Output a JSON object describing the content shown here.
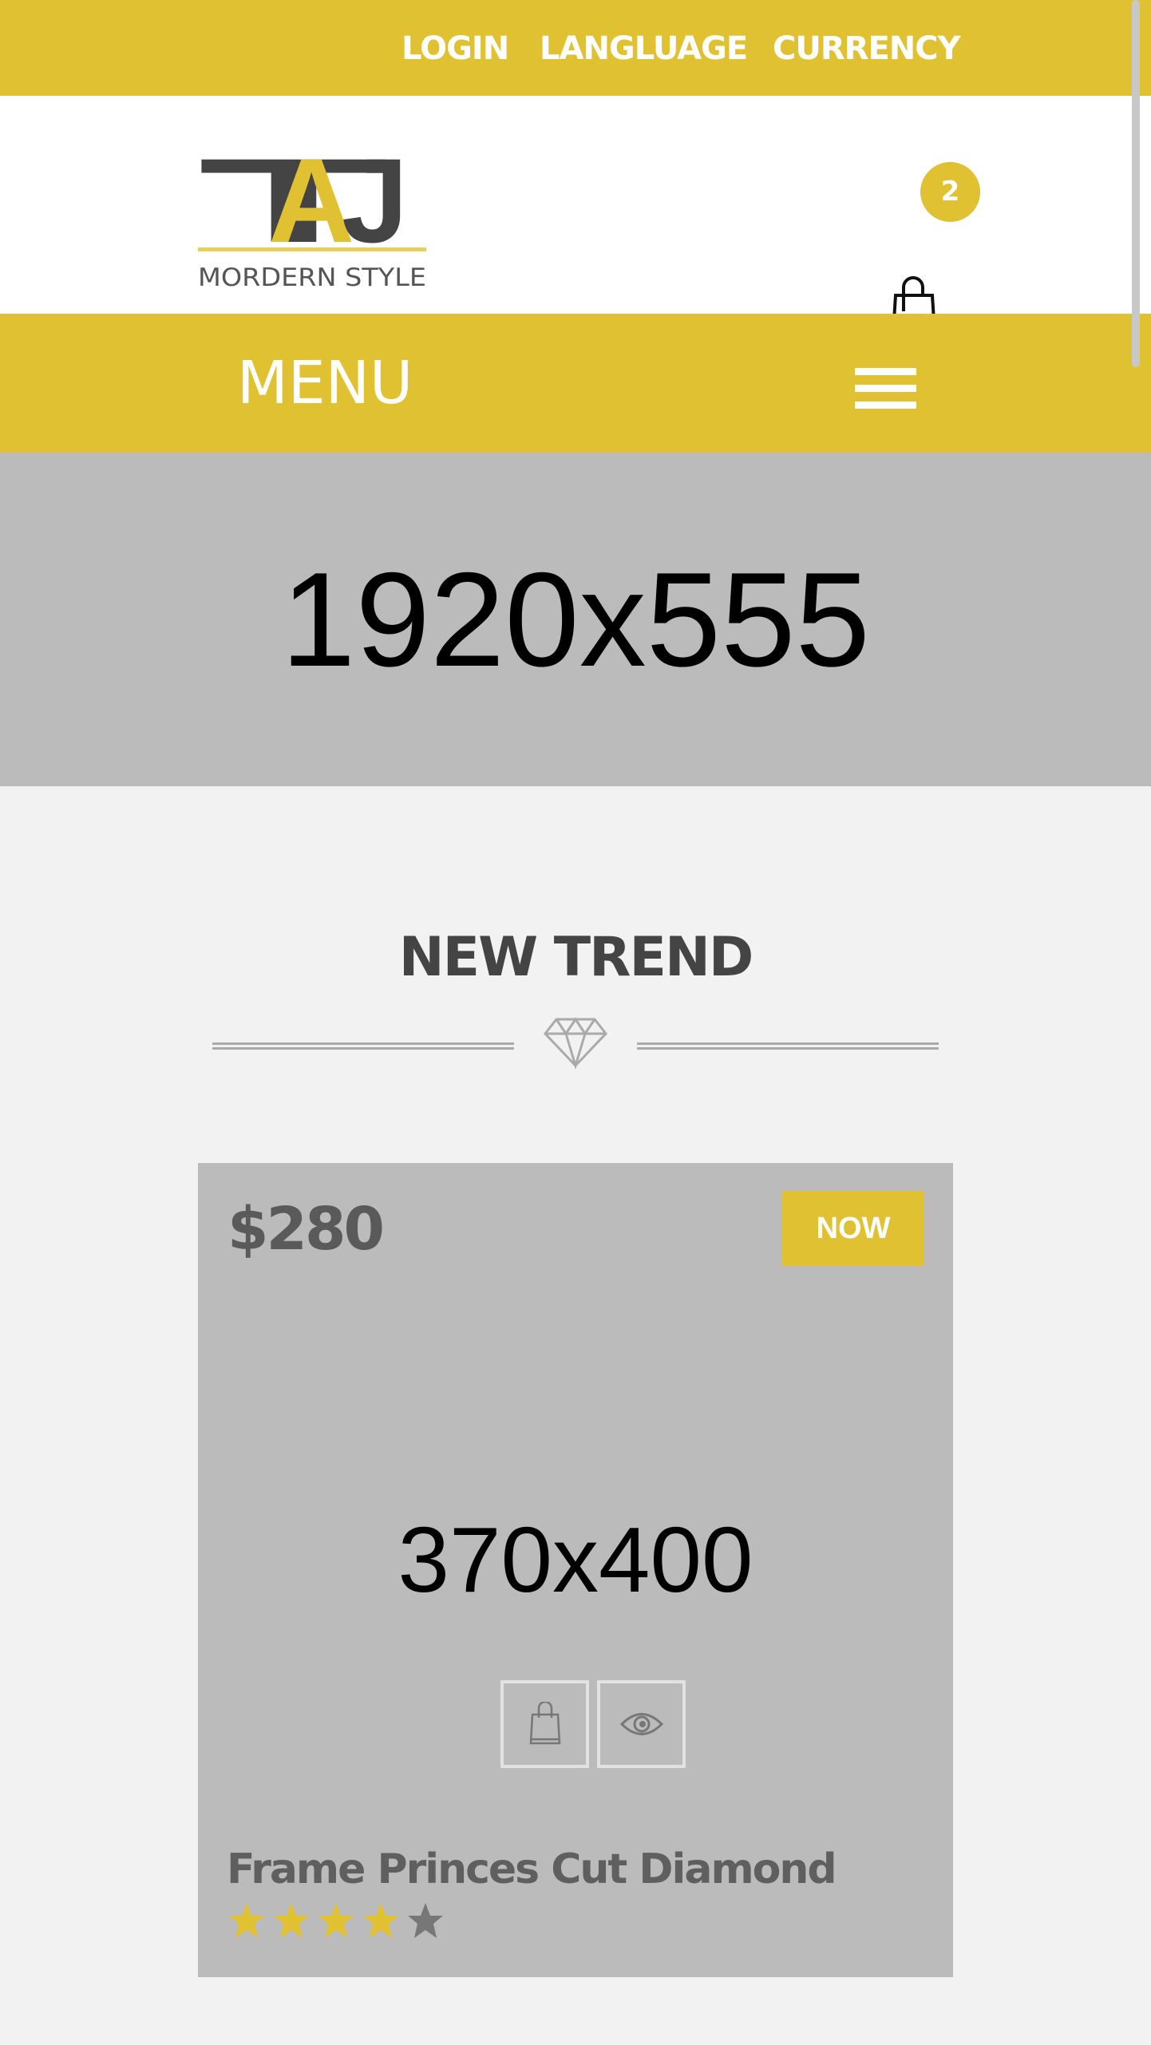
{
  "topbar": {
    "links": [
      "LOGIN",
      "LANGLUAGE",
      "CURRENCY"
    ]
  },
  "header": {
    "logo_text": "TAJ",
    "logo_tagline": "MORDERN STYLE",
    "cart_count": "2"
  },
  "menu": {
    "label": "MENU"
  },
  "banner": {
    "placeholder": "1920x555"
  },
  "section": {
    "title": "NEW TREND"
  },
  "product": {
    "price": "$280",
    "badge": "NOW",
    "image_placeholder": "370x400",
    "title": "Frame Princes Cut Diamond",
    "rating": 4,
    "rating_max": 5
  },
  "colors": {
    "accent": "#dfc132",
    "card": "#bbbbbb",
    "star_off": "#777777"
  }
}
